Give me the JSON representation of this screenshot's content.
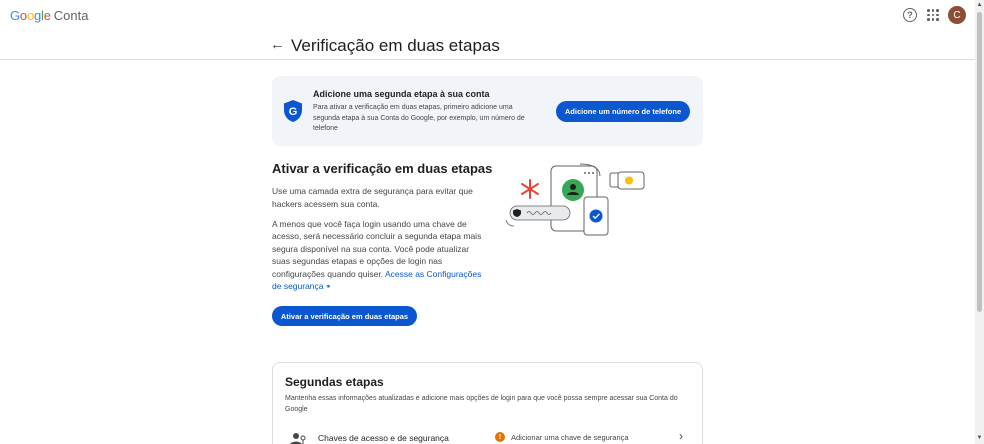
{
  "app": {
    "logo_letters": [
      "G",
      "o",
      "o",
      "g",
      "l",
      "e"
    ],
    "product": "Conta",
    "avatar_initial": "C",
    "help_icon": "help-circle-icon",
    "apps_icon": "apps-grid-icon"
  },
  "header": {
    "title": "Verificação em duas etapas",
    "back_icon": "arrow-back-icon"
  },
  "banner": {
    "title": "Adicione uma segunda etapa à sua conta",
    "text": "Para ativar a verificação em duas etapas, primeiro adicione uma segunda etapa à sua Conta do Google, por exemplo, um número de telefone",
    "button": "Adicione um número de telefone",
    "icon": "shield-icon"
  },
  "activate": {
    "title": "Ativar a verificação em duas etapas",
    "para1": "Use uma camada extra de segurança para evitar que hackers acessem sua conta.",
    "para2": "A menos que você faça login usando uma chave de acesso, será necessário concluir a segunda etapa mais segura disponível na sua conta. Você pode atualizar suas segundas etapas e opções de login nas configurações quando quiser.",
    "link": "Acesse as Configurações de segurança",
    "button": "Ativar a verificação em duas etapas"
  },
  "steps": {
    "title": "Segundas etapas",
    "description": "Mantenha essas informações atualizadas e adicione mais opções de login para que você possa sempre acessar sua Conta do Google",
    "rows": [
      {
        "label": "Chaves de acesso e de segurança",
        "status": "Adicionar uma chave de segurança",
        "icon": "passkey-person-icon",
        "status_icon": "warning-icon"
      }
    ]
  },
  "colors": {
    "primary": "#0b57d0",
    "banner_bg": "#f1f4f9",
    "warning": "#e37400",
    "avatar": "#8d4e36"
  }
}
